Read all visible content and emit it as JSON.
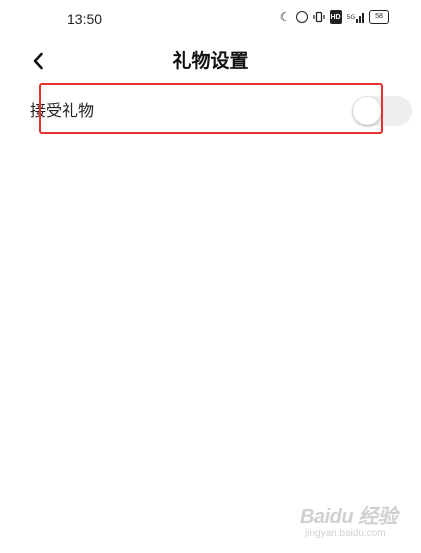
{
  "status_bar": {
    "time": "13:50",
    "hd_label": "HD",
    "battery": "58",
    "network": "5G"
  },
  "nav": {
    "title": "礼物设置",
    "back_icon": "chevron-left-icon"
  },
  "settings": [
    {
      "label": "接受礼物",
      "enabled": false
    }
  ],
  "highlight_color": "#e5322d",
  "watermark": {
    "brand": "Baidu 经验",
    "url": "jingyan.baidu.com"
  }
}
